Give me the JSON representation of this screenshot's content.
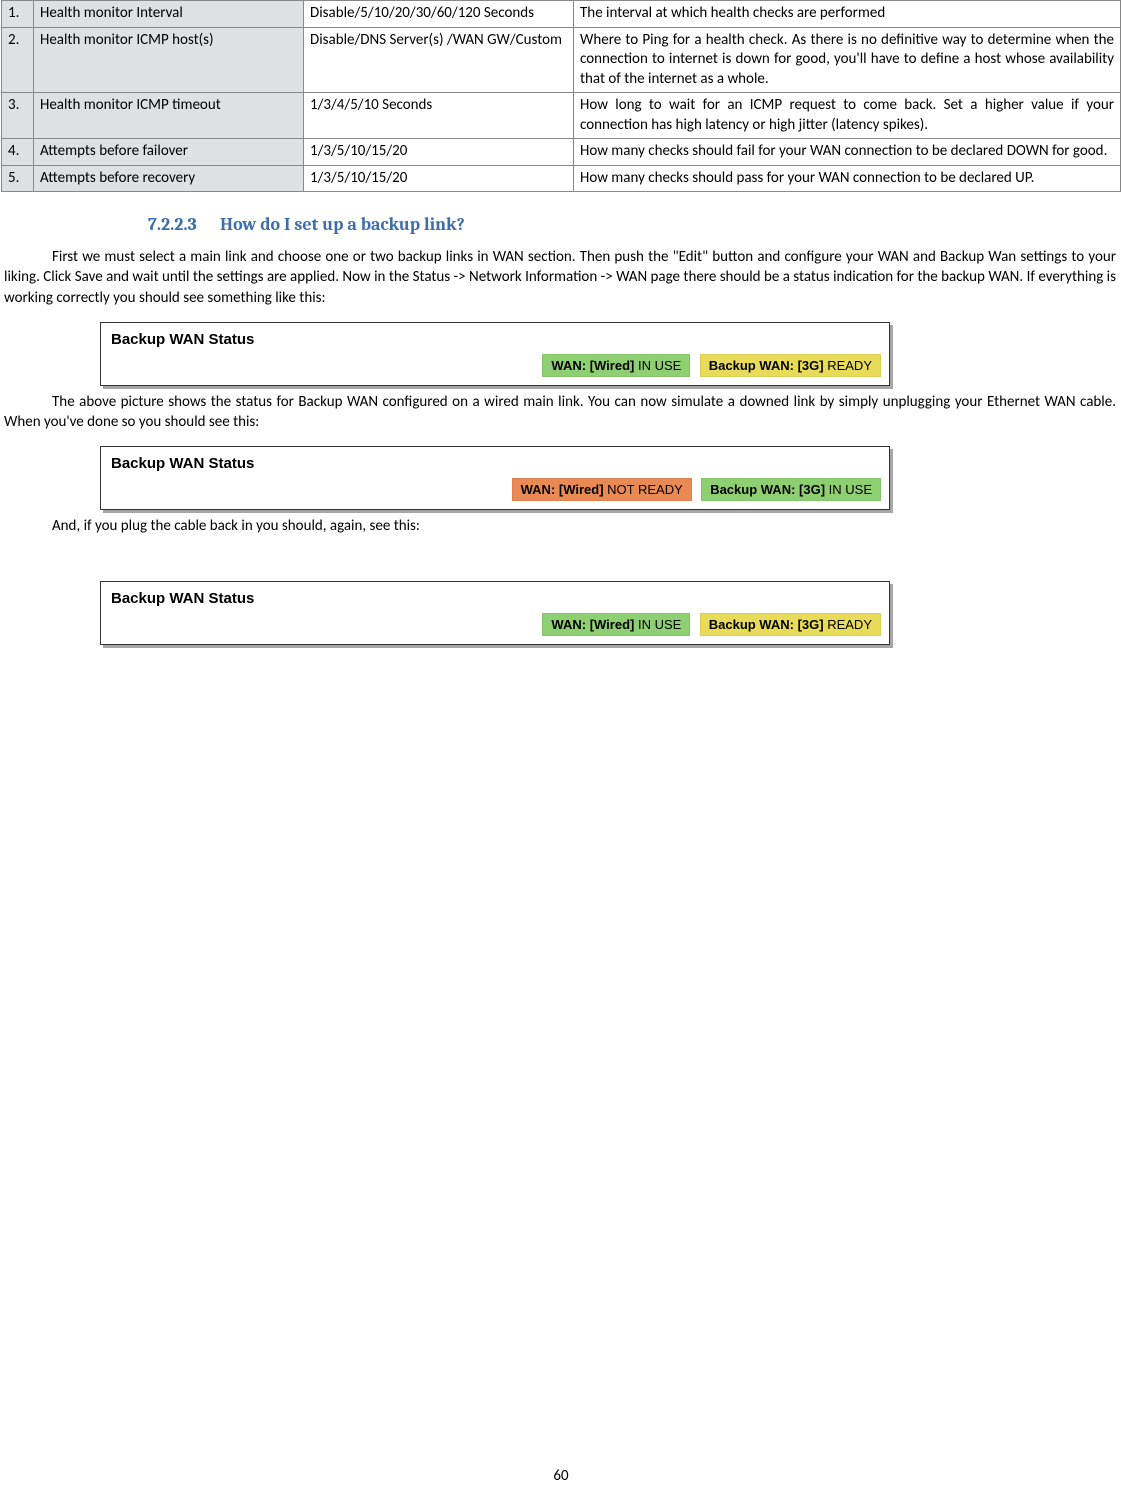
{
  "table": {
    "rows": [
      {
        "num": "1.",
        "name": "Health monitor Interval",
        "opts": "Disable/5/10/20/30/60/120 Seconds",
        "desc": "The interval at which health checks are performed"
      },
      {
        "num": "2.",
        "name": "Health monitor ICMP host(s)",
        "opts": "Disable/DNS Server(s) /WAN GW/Custom",
        "desc": "Where to Ping for a health check. As there is no definitive way to determine when the connection to internet is down for good, you'll have to define a host whose availability that of the internet as a whole."
      },
      {
        "num": "3.",
        "name": "Health monitor ICMP timeout",
        "opts": "1/3/4/5/10 Seconds",
        "desc": "How long to wait for an ICMP request to come back. Set a higher value if your connection has high latency or high jitter (latency spikes)."
      },
      {
        "num": "4.",
        "name": "Attempts before failover",
        "opts": "1/3/5/10/15/20",
        "desc": "How many checks should fail for your WAN connection to be declared DOWN for good."
      },
      {
        "num": "5.",
        "name": "Attempts before recovery",
        "opts": "1/3/5/10/15/20",
        "desc": "How many checks should pass for your WAN connection to be declared UP."
      }
    ]
  },
  "section": {
    "number": "7.2.2.3",
    "title": "How do I set up a backup link?"
  },
  "paragraphs": {
    "p1": "First we must select a main link and choose one or two backup links in WAN section. Then push the \"Edit\" button and configure your WAN and Backup Wan settings to your liking. Click Save and wait until the settings are applied. Now in the Status -> Network Information -> WAN page there should be a status indication for the backup WAN. If everything is working correctly you should see something like this:",
    "p2": "The above picture shows the status for Backup WAN configured on a wired main link. You can now simulate a downed link by simply unplugging your Ethernet WAN cable. When you've done so you should see this:",
    "p3": "And, if you plug the cable back in you should, again, see this:"
  },
  "status": {
    "title": "Backup WAN Status",
    "s1": {
      "left_label": "WAN: [Wired]",
      "left_state": "IN USE",
      "right_label": "Backup WAN: [3G]",
      "right_state": "READY"
    },
    "s2": {
      "left_label": "WAN: [Wired]",
      "left_state": "NOT READY",
      "right_label": "Backup WAN: [3G]",
      "right_state": "IN USE"
    },
    "s3": {
      "left_label": "WAN: [Wired]",
      "left_state": "IN USE",
      "right_label": "Backup WAN: [3G]",
      "right_state": "READY"
    }
  },
  "page_number": "60"
}
